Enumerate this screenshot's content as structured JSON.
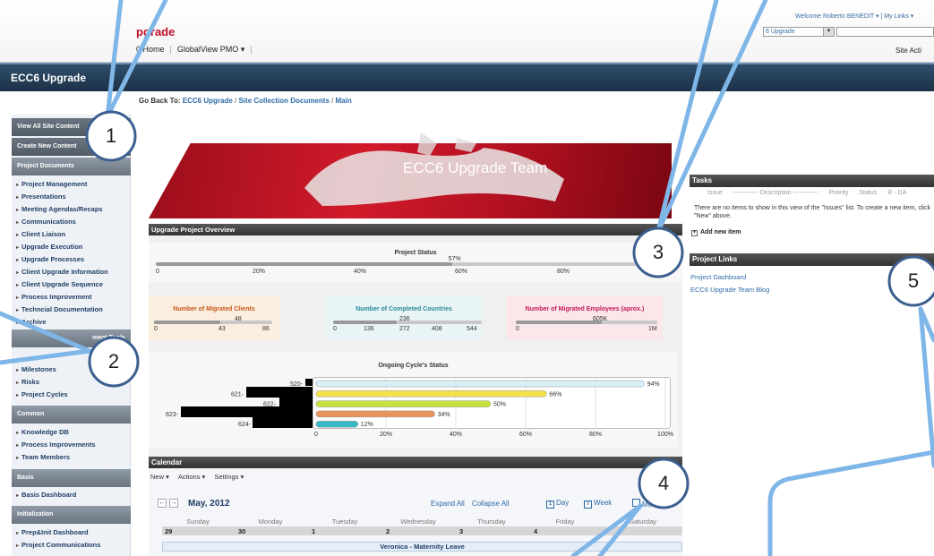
{
  "top": {
    "brand": "pgrade",
    "nav_home": "0 Home",
    "nav_pmo": "GlobalView PMO ▾",
    "welcome": "Welcome Roberto BENEDIT ▾  |  My Links ▾",
    "site_select": "6 Upgrade",
    "site_actions": "Site Acti"
  },
  "site_title": "ECC6 Upgrade",
  "breadcrumb": {
    "label": "Go Back To:",
    "crumbs": [
      "ECC6 Upgrade",
      "Site Collection Documents",
      "Main"
    ]
  },
  "leftnav": {
    "view_all": "View All Site Content",
    "create_new": "Create New Content",
    "project_documents": "Project Documents",
    "docs": [
      "Project Management",
      "Presentations",
      "Meeting Agendas/Recaps",
      "Communications",
      "Client Liaison",
      "Upgrade Execution",
      "Upgrade Processes",
      "Client Upgrade Information",
      "Client Upgrade Sequence",
      "Process Improvement",
      "Techncial Documentation",
      "Archive"
    ],
    "mgmt_head": "ment Tools",
    "mgmt": [
      "Milestones",
      "Risks",
      "Project Cycles"
    ],
    "common_head": "Common",
    "common": [
      "Knowledge DB",
      "Process Improvements",
      "Team Members"
    ],
    "basis_head": "Basis",
    "basis": [
      "Basis Dashboard"
    ],
    "init_head": "Initialization",
    "init": [
      "Prep&Init Dashboard",
      "Project Communications"
    ]
  },
  "banner_title": "ECC6 Upgrade Team",
  "overview": {
    "header": "Upgrade Project Overview",
    "status_title": "Project Status",
    "status_value": 0.57,
    "status_label": "57%",
    "status_ticks": [
      "0",
      "20%",
      "40%",
      "60%",
      "80%",
      "100%"
    ],
    "kpis": [
      {
        "title": "Number of Migrated Clients",
        "value_label": "48",
        "value": 0.56,
        "ticks": [
          "0",
          "43",
          "86"
        ],
        "color": "#c65a1e"
      },
      {
        "title": "Number of Completed Countries",
        "value_label": "236",
        "value": 0.43,
        "ticks": [
          "0",
          "136",
          "272",
          "408",
          "544"
        ],
        "color": "#2a8a97"
      },
      {
        "title": "Number of Migrated Employees (aprox.)",
        "value_label": "605K",
        "value": 0.605,
        "ticks": [
          "0",
          "1M"
        ],
        "color": "#c2185b"
      }
    ]
  },
  "chart_data": {
    "type": "bar",
    "title": "Ongoing Cycle's Status",
    "categories": [
      "520-",
      "621-",
      "622-",
      "623-",
      "624-"
    ],
    "values": [
      94,
      66,
      50,
      34,
      12
    ],
    "value_labels": [
      "94%",
      "66%",
      "50%",
      "34%",
      "12%"
    ],
    "colors": [
      "#d8eef8",
      "#f3e14a",
      "#c7e23c",
      "#e8935a",
      "#39b9c4"
    ],
    "xlim": [
      0,
      100
    ],
    "ticks": [
      "0",
      "20%",
      "40%",
      "60%",
      "80%",
      "100%"
    ]
  },
  "calendar": {
    "header": "Calendar",
    "toolbar": [
      "New ▾",
      "Actions ▾",
      "Settings ▾"
    ],
    "month": "May, 2012",
    "expand": "Expand All",
    "collapse": "Collapse All",
    "view_day": "Day",
    "view_week": "Week",
    "view_month": "Mont",
    "day_icon": "1",
    "week_icon": "7",
    "daynames": [
      "Sunday",
      "Monday",
      "Tuesday",
      "Wednesday",
      "Thursday",
      "Friday",
      "Saturday"
    ],
    "daynums": [
      "29",
      "30",
      "1",
      "2",
      "3",
      "4"
    ],
    "event": "Veronica - Maternity Leave"
  },
  "tasks": {
    "header": "Tasks",
    "cols": [
      "Issue",
      "------------ Description ------------",
      "Priority",
      "Status",
      "R - DA"
    ],
    "empty": "There are no items to show in this view of the \"Issues\" list. To create a new item, click \"New\" above.",
    "add": "Add new item"
  },
  "links": {
    "header": "Project Links",
    "items": [
      "Project Dashboard",
      "ECC6 Upgrade Team Blog"
    ]
  },
  "callouts": [
    "1",
    "2",
    "3",
    "4",
    "5"
  ]
}
